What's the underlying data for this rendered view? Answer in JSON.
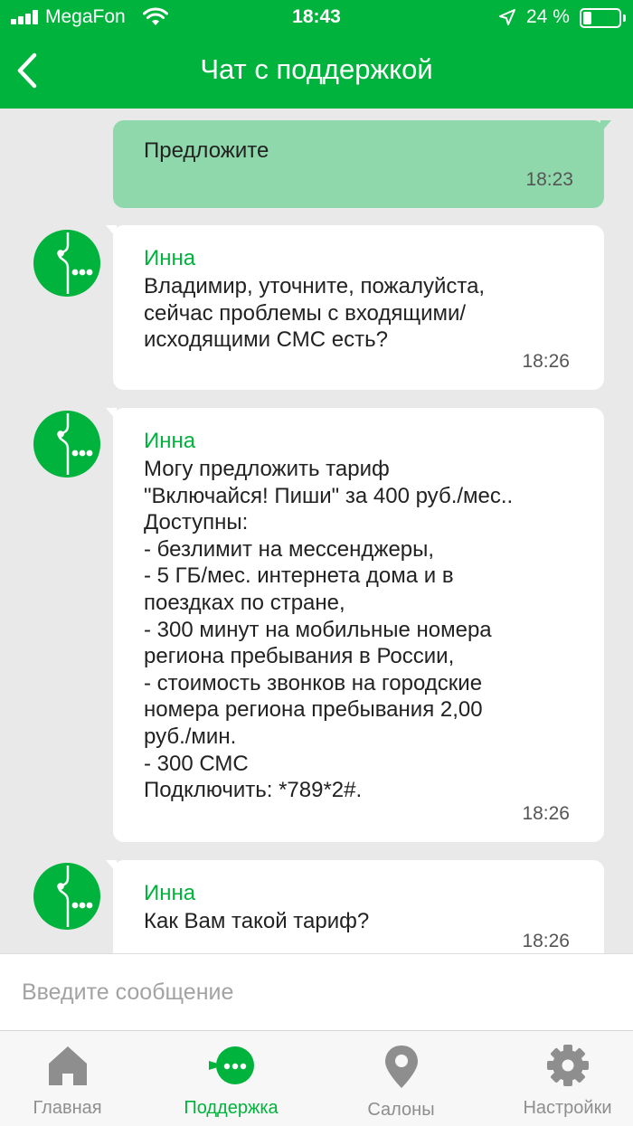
{
  "status_bar": {
    "carrier": "MegaFon",
    "time": "18:43",
    "battery_percent": "24 %",
    "battery_level": 0.24
  },
  "header": {
    "title": "Чат с поддержкой",
    "back_icon": "chevron-left-icon"
  },
  "messages": [
    {
      "direction": "outgoing",
      "text": "Предложите",
      "time": "18:23"
    },
    {
      "direction": "incoming",
      "author": "Инна",
      "text": "Владимир, уточните, пожалуйста,\nсейчас проблемы с входящими/\nисходящими СМС есть?",
      "time": "18:26"
    },
    {
      "direction": "incoming",
      "author": "Инна",
      "text": "Могу предложить тариф\n\"Включайся! Пиши\" за 400 руб./мес..\nДоступны:\n- безлимит на мессенджеры,\n- 5 ГБ/мес. интернета дома и в\nпоездках по стране,\n- 300 минут на мобильные номера\nрегиона пребывания в России,\n- стоимость звонков на городские\nномера региона пребывания 2,00\nруб./мин.\n- 300 СМС\nПодключить: *789*2#.",
      "time": "18:26"
    },
    {
      "direction": "incoming",
      "author": "Инна",
      "text": "Как Вам такой тариф?",
      "time": "18:26"
    }
  ],
  "composer": {
    "placeholder": "Введите сообщение"
  },
  "tabs": [
    {
      "label": "Главная",
      "icon": "home-icon",
      "active": false
    },
    {
      "label": "Поддержка",
      "icon": "chat-bubble-icon",
      "active": true
    },
    {
      "label": "Салоны",
      "icon": "map-pin-icon",
      "active": false
    },
    {
      "label": "Настройки",
      "icon": "gear-icon",
      "active": false
    }
  ],
  "colors": {
    "brand_green": "#00b33c",
    "outgoing_bubble": "#8fd8ab",
    "background": "#e9e9e9"
  }
}
